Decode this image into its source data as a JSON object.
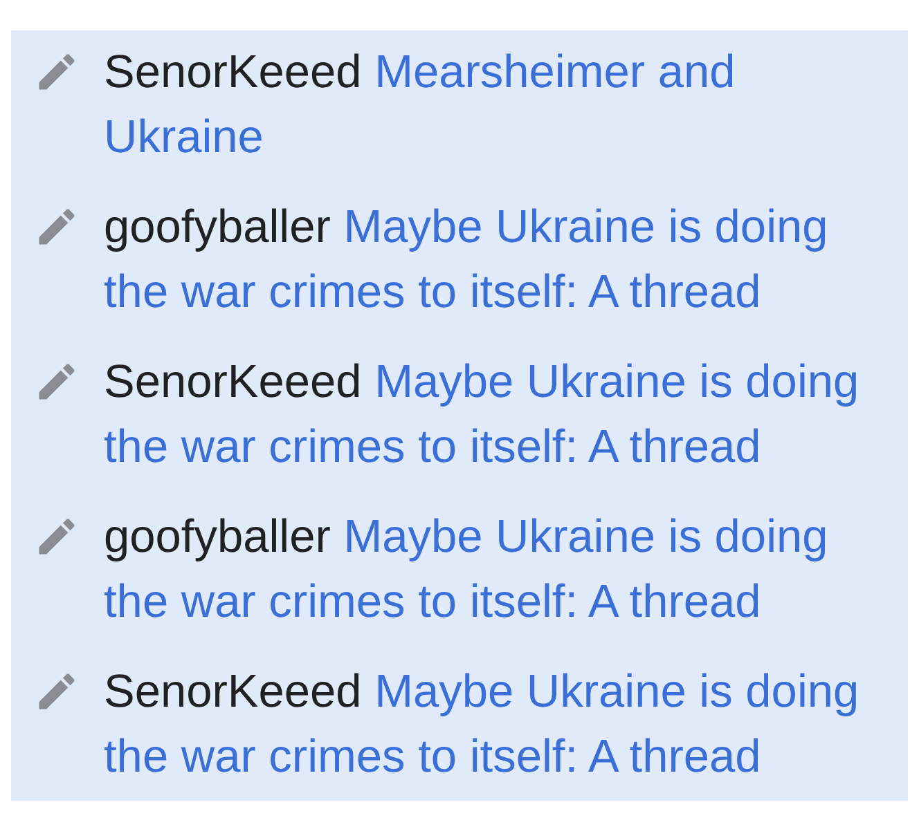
{
  "edits": [
    {
      "user": "SenorKeeed",
      "title": "Mearsheimer and Ukraine"
    },
    {
      "user": "goofyballer",
      "title": "Maybe Ukraine is doing the war crimes to itself: A thread"
    },
    {
      "user": "SenorKeeed",
      "title": "Maybe Ukraine is doing the war crimes to itself: A thread"
    },
    {
      "user": "goofyballer",
      "title": "Maybe Ukraine is doing the war crimes to itself: A thread"
    },
    {
      "user": "SenorKeeed",
      "title": "Maybe Ukraine is doing the war crimes to itself: A thread"
    }
  ]
}
